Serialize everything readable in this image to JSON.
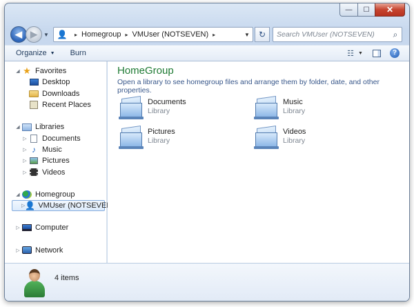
{
  "window": {
    "controls": {
      "minimize": "—",
      "maximize": "☐",
      "close": "✕"
    }
  },
  "address": {
    "crumbs": [
      "Homegroup",
      "VMUser (NOTSEVEN)"
    ],
    "separator": "▸"
  },
  "search": {
    "placeholder": "Search VMUser (NOTSEVEN)"
  },
  "toolbar": {
    "organize_label": "Organize",
    "burn_label": "Burn"
  },
  "sidebar": {
    "favorites": {
      "label": "Favorites",
      "items": [
        "Desktop",
        "Downloads",
        "Recent Places"
      ]
    },
    "libraries": {
      "label": "Libraries",
      "items": [
        "Documents",
        "Music",
        "Pictures",
        "Videos"
      ]
    },
    "homegroup": {
      "label": "Homegroup",
      "items": [
        "VMUser (NOTSEVEN)"
      ]
    },
    "computer": {
      "label": "Computer"
    },
    "network": {
      "label": "Network"
    }
  },
  "content": {
    "title": "HomeGroup",
    "subtitle": "Open a library to see homegroup files and arrange them by folder, date, and other properties.",
    "libraries": [
      {
        "name": "Documents",
        "kind": "Library"
      },
      {
        "name": "Music",
        "kind": "Library"
      },
      {
        "name": "Pictures",
        "kind": "Library"
      },
      {
        "name": "Videos",
        "kind": "Library"
      }
    ]
  },
  "details": {
    "item_count": "4 items"
  },
  "colors": {
    "title_green": "#1e7a33",
    "link_blue": "#38578a",
    "close_red": "#c6442f"
  }
}
